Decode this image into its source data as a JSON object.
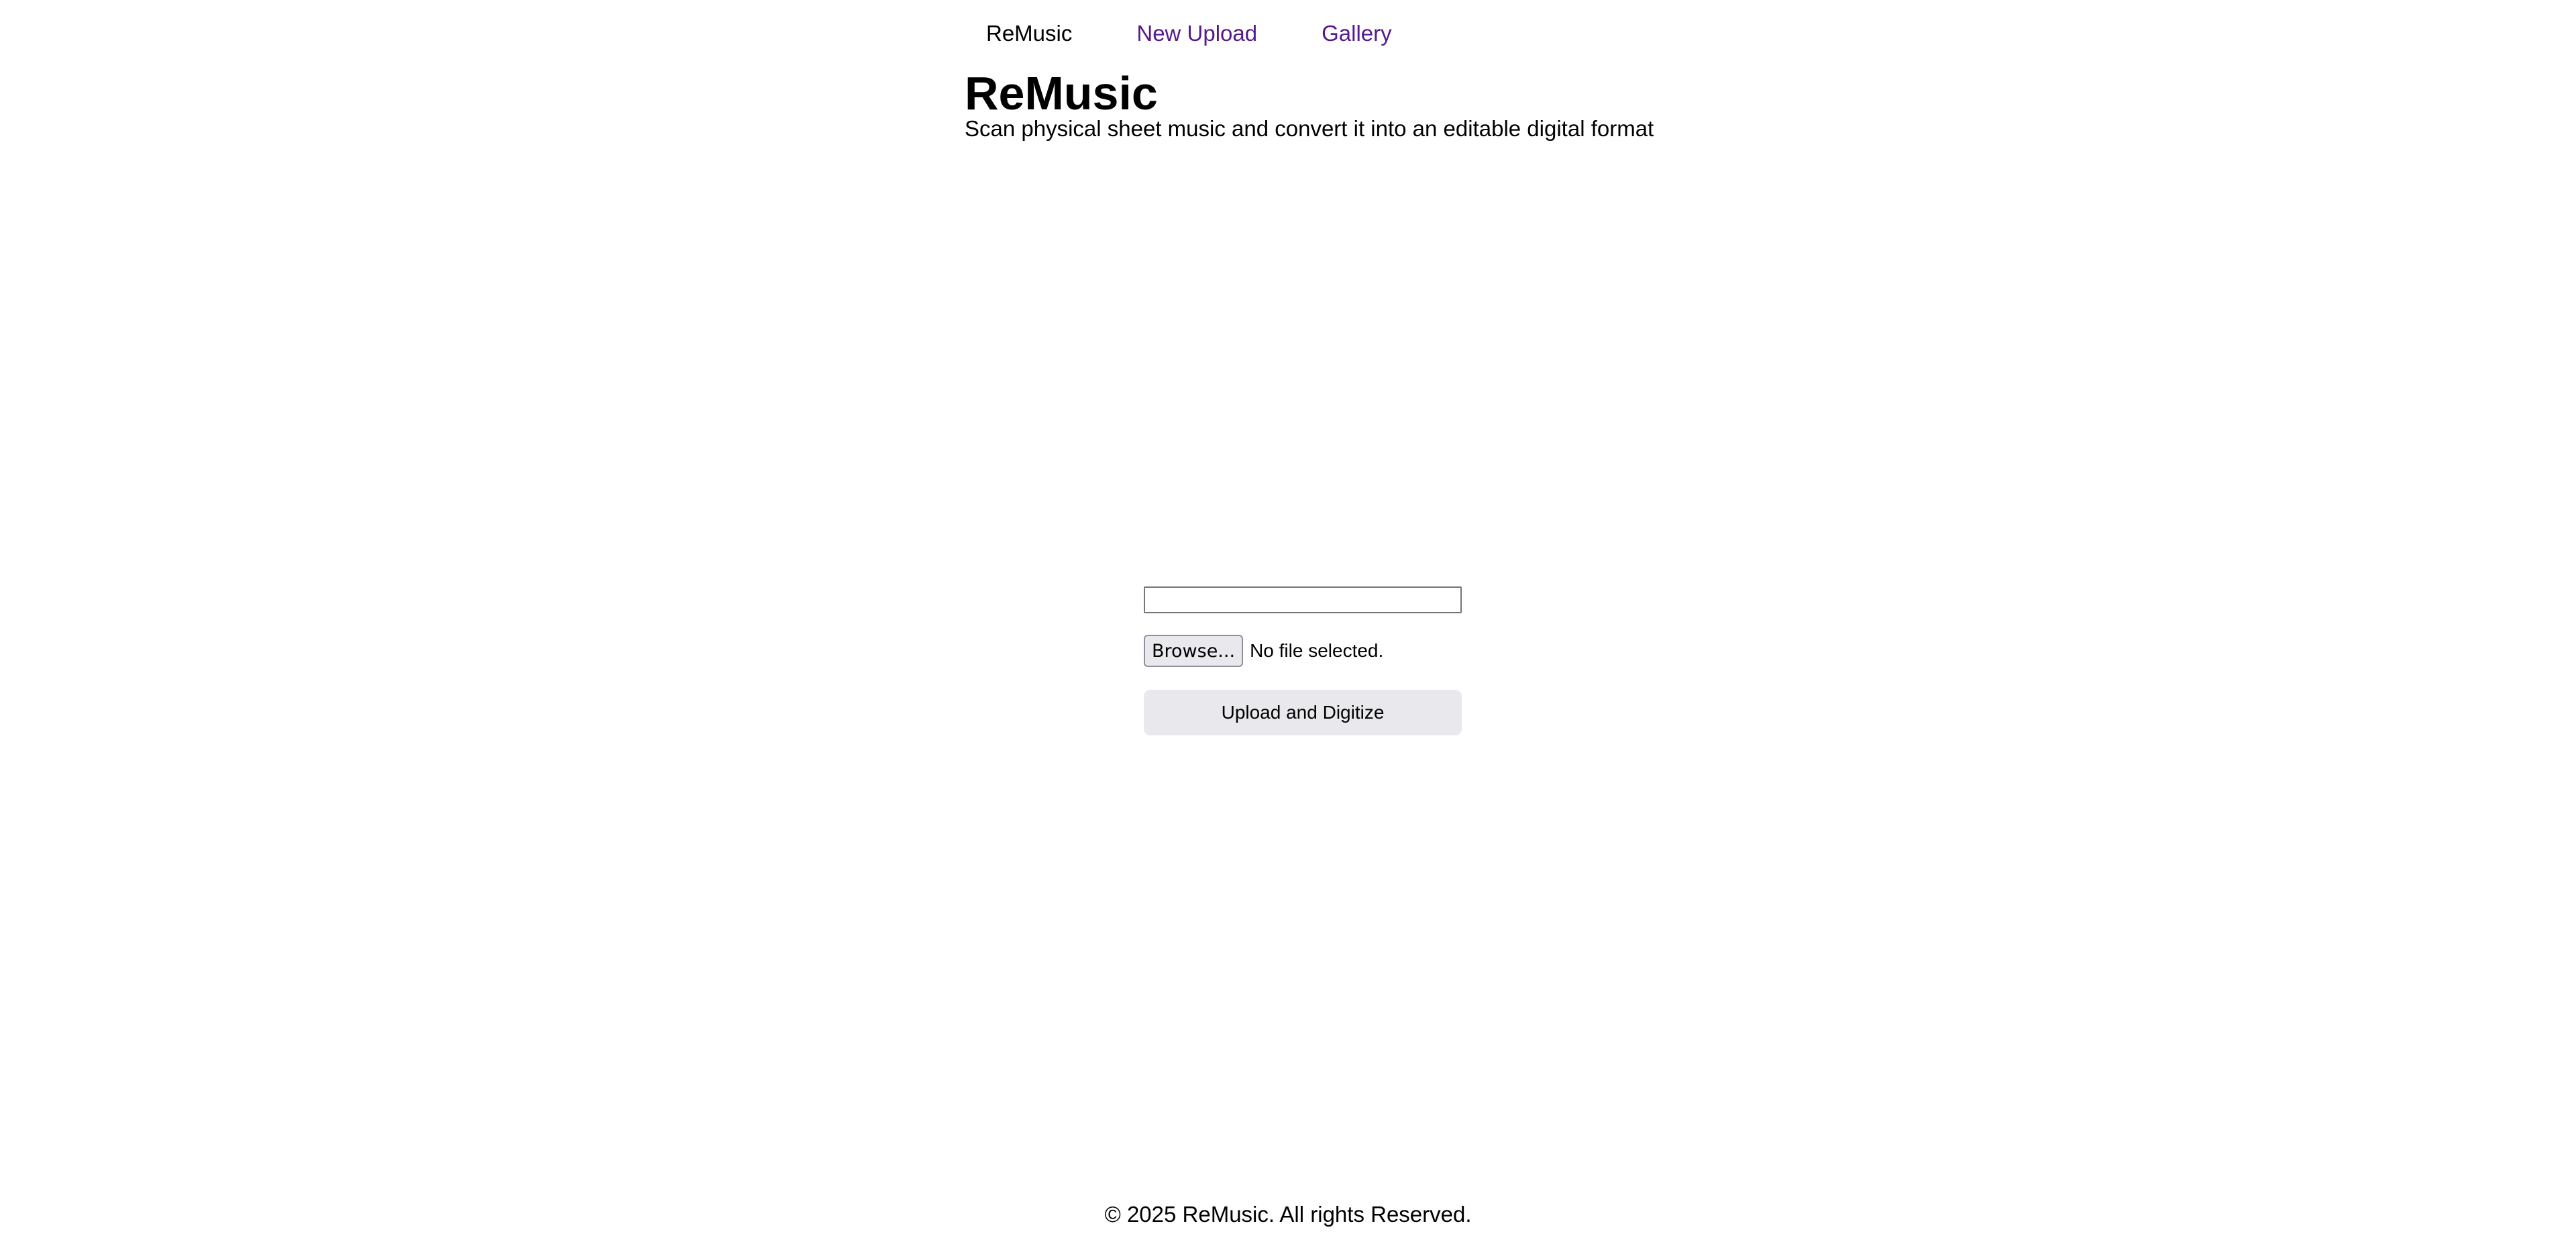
{
  "nav": {
    "brand": "ReMusic",
    "links": [
      {
        "label": "New Upload"
      },
      {
        "label": "Gallery"
      }
    ]
  },
  "header": {
    "title": "ReMusic",
    "subtitle": "Scan physical sheet music and convert it into an editable digital format"
  },
  "form": {
    "text_value": "",
    "browse_label": "Browse...",
    "file_status": "No file selected.",
    "submit_label": "Upload and Digitize"
  },
  "footer": {
    "text": "© 2025 ReMusic. All rights Reserved."
  },
  "colors": {
    "link": "#551a8b",
    "button_bg": "#e9e9ed"
  }
}
